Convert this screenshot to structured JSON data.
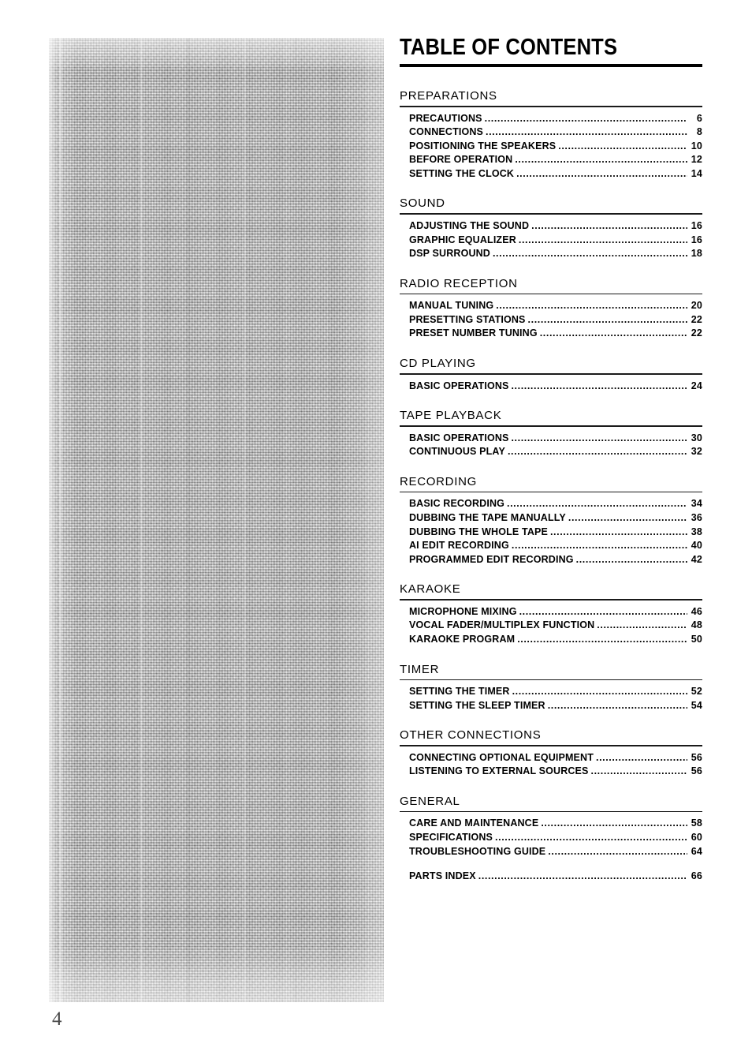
{
  "document": {
    "title": "TABLE OF CONTENTS",
    "page_number": "4"
  },
  "sections": [
    {
      "header": "PREPARATIONS",
      "entries": [
        {
          "label": "PRECAUTIONS",
          "page": "6"
        },
        {
          "label": "CONNECTIONS",
          "page": "8"
        },
        {
          "label": "POSITIONING THE SPEAKERS",
          "page": "10"
        },
        {
          "label": "BEFORE OPERATION",
          "page": "12"
        },
        {
          "label": "SETTING THE CLOCK",
          "page": "14"
        }
      ]
    },
    {
      "header": "SOUND",
      "entries": [
        {
          "label": "ADJUSTING THE SOUND",
          "page": "16"
        },
        {
          "label": "GRAPHIC EQUALIZER",
          "page": "16"
        },
        {
          "label": "DSP SURROUND",
          "page": "18"
        }
      ]
    },
    {
      "header": "RADIO RECEPTION",
      "entries": [
        {
          "label": "MANUAL TUNING",
          "page": "20"
        },
        {
          "label": "PRESETTING STATIONS",
          "page": "22"
        },
        {
          "label": "PRESET NUMBER TUNING",
          "page": "22"
        }
      ]
    },
    {
      "header": "CD PLAYING",
      "entries": [
        {
          "label": "BASIC OPERATIONS",
          "page": "24"
        }
      ]
    },
    {
      "header": "TAPE PLAYBACK",
      "entries": [
        {
          "label": "BASIC OPERATIONS",
          "page": "30"
        },
        {
          "label": "CONTINUOUS PLAY",
          "page": "32"
        }
      ]
    },
    {
      "header": "RECORDING",
      "entries": [
        {
          "label": "BASIC RECORDING",
          "page": "34"
        },
        {
          "label": "DUBBING THE TAPE MANUALLY",
          "page": "36"
        },
        {
          "label": "DUBBING THE WHOLE TAPE",
          "page": "38"
        },
        {
          "label": "AI EDIT RECORDING",
          "page": "40"
        },
        {
          "label": "PROGRAMMED EDIT RECORDING",
          "page": "42"
        }
      ]
    },
    {
      "header": "KARAOKE",
      "entries": [
        {
          "label": "MICROPHONE MIXING",
          "page": "46"
        },
        {
          "label": "VOCAL FADER/MULTIPLEX FUNCTION",
          "page": "48"
        },
        {
          "label": "KARAOKE PROGRAM",
          "page": "50"
        }
      ]
    },
    {
      "header": "TIMER",
      "entries": [
        {
          "label": "SETTING THE TIMER",
          "page": "52"
        },
        {
          "label": "SETTING THE SLEEP TIMER",
          "page": "54"
        }
      ]
    },
    {
      "header": "OTHER CONNECTIONS",
      "entries": [
        {
          "label": "CONNECTING OPTIONAL EQUIPMENT",
          "page": "56"
        },
        {
          "label": "LISTENING TO EXTERNAL SOURCES",
          "page": "56"
        }
      ]
    },
    {
      "header": "GENERAL",
      "entries": [
        {
          "label": "CARE AND MAINTENANCE",
          "page": "58"
        },
        {
          "label": "SPECIFICATIONS",
          "page": "60"
        },
        {
          "label": "TROUBLESHOOTING GUIDE",
          "page": "64"
        },
        {
          "label": "PARTS INDEX",
          "page": "66",
          "gap_above": true
        }
      ]
    }
  ]
}
